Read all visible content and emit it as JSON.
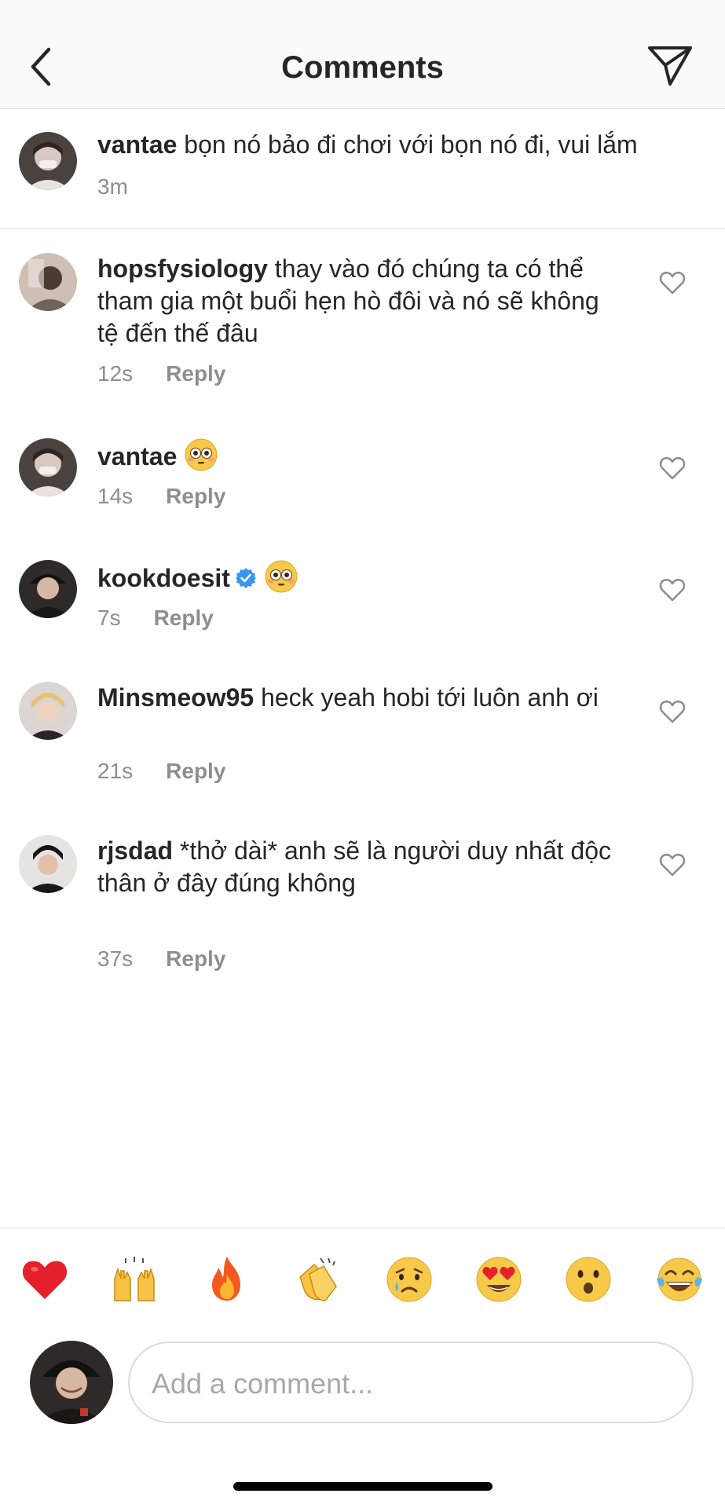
{
  "header": {
    "title": "Comments",
    "back_icon": "chevron-left-icon",
    "send_icon": "paper-plane-icon"
  },
  "caption": {
    "username": "vantae",
    "text": " bọn nó bảo đi chơi với bọn nó đi, vui lắm",
    "time": "3m"
  },
  "comments": [
    {
      "username": "hopsfysiology",
      "text": " thay vào đó chúng ta có thể tham gia một buổi hẹn hò đôi và nó sẽ không tệ đến thế đâu",
      "time": "12s",
      "reply": "Reply"
    },
    {
      "username": "vantae",
      "text": "",
      "emoji": "flushed-face",
      "time": "14s",
      "reply": "Reply"
    },
    {
      "username": "kookdoesit",
      "verified": true,
      "text": "",
      "emoji": "flushed-face",
      "time": "7s",
      "reply": "Reply"
    },
    {
      "username": "Minsmeow95",
      "text": " heck yeah hobi tới luôn anh ơi",
      "time": "21s",
      "reply": "Reply"
    },
    {
      "username": "rjsdad",
      "text": " *thở dài* anh sẽ là người duy nhất độc thân ở đây đúng không",
      "time": "37s",
      "reply": "Reply"
    }
  ],
  "quick_reactions": [
    "red-heart",
    "raising-hands",
    "fire",
    "clapping-hands",
    "crying-face",
    "heart-eyes",
    "surprised-face",
    "tears-of-joy"
  ],
  "composer": {
    "placeholder": "Add a comment..."
  },
  "colors": {
    "text": "#262626",
    "muted": "#8e8e8e",
    "border": "#dbdbdb",
    "verified": "#3897f0"
  }
}
